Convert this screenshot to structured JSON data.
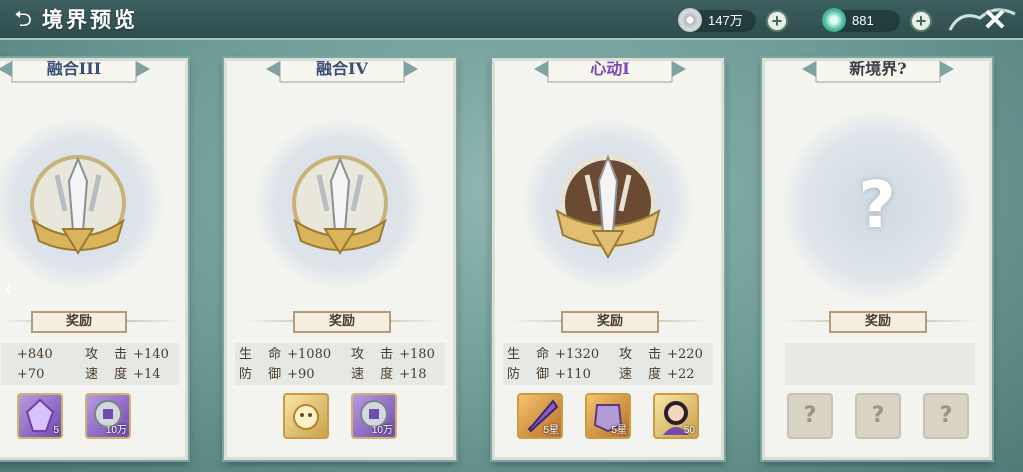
{
  "header": {
    "title": "境界预览",
    "silver": "147万",
    "jade": "881",
    "plus": "+",
    "close": "✕",
    "back": "⮌"
  },
  "cards": [
    {
      "name": "融合III",
      "reward": "奖励",
      "stats": [
        [
          "",
          "+840"
        ],
        [
          "攻 击",
          "+140"
        ],
        [
          "",
          "+70"
        ],
        [
          "速 度",
          "+14"
        ]
      ],
      "items": [
        {
          "type": "purple-crystal",
          "count": "5"
        },
        {
          "type": "coin",
          "count": "10万"
        }
      ]
    },
    {
      "name": "融合IV",
      "reward": "奖励",
      "stats": [
        [
          "生 命",
          "+1080"
        ],
        [
          "攻 击",
          "+180"
        ],
        [
          "防 御",
          "+90"
        ],
        [
          "速 度",
          "+18"
        ]
      ],
      "items": [
        {
          "type": "gold-spirit",
          "count": ""
        },
        {
          "type": "coin",
          "count": "10万"
        }
      ]
    },
    {
      "name": "心动I",
      "reward": "奖励",
      "stats": [
        [
          "生 命",
          "+1320"
        ],
        [
          "攻 击",
          "+220"
        ],
        [
          "防 御",
          "+110"
        ],
        [
          "速 度",
          "+22"
        ]
      ],
      "items": [
        {
          "type": "dagger",
          "count": "5星"
        },
        {
          "type": "armor",
          "count": "5星"
        },
        {
          "type": "hero",
          "count": "50"
        }
      ]
    },
    {
      "name": "新境界?",
      "reward": "奖励",
      "stats": [],
      "items": [
        {
          "type": "unknown",
          "count": "?"
        },
        {
          "type": "unknown",
          "count": "?"
        },
        {
          "type": "unknown",
          "count": "?"
        }
      ]
    }
  ],
  "colors": {
    "accent": "#7b46b8",
    "ribbon_text": "#3a4f78",
    "gold": "#caa14d"
  }
}
